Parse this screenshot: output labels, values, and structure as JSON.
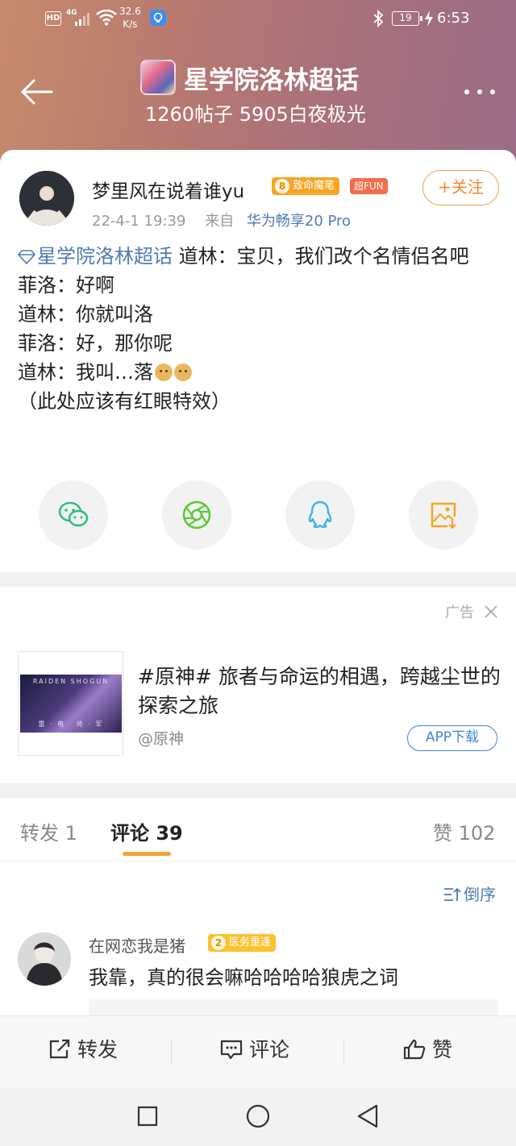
{
  "status_bar": {
    "hd": "HD",
    "network": "4G",
    "speed_value": "32.6",
    "speed_unit": "K/s",
    "battery": "19",
    "time": "6:53"
  },
  "header": {
    "topic_title": "星学院洛林超话",
    "topic_stats": "1260帖子 5905白夜极光"
  },
  "post": {
    "author": "梦里风在说着谁yu",
    "level_num": "8",
    "level_badge": "致命魔笔",
    "fun_badge": "超FUN",
    "follow_label": "+关注",
    "date": "22-4-1 19:39",
    "source_prefix": "来自",
    "device": "华为畅享20 Pro",
    "topic_link": "星学院洛林超话",
    "lines": [
      " 道林：宝贝，我们改个名情侣名吧",
      "菲洛：好啊",
      "道林：你就叫洛",
      "菲洛：好，那你呢",
      "道林：我叫…落",
      "（此处应该有红眼特效）"
    ]
  },
  "share": {
    "icons": [
      "wechat-icon",
      "moments-icon",
      "qq-icon",
      "save-image-icon"
    ]
  },
  "ad": {
    "label": "广告",
    "title": "#原神# 旅者与命运的相遇，跨越尘世的探索之旅",
    "source": "@原神",
    "button": "APP下载",
    "thumb_top": "RAIDEN SHOGUN",
    "thumb_bottom": "雷 · 电 · 将 · 军"
  },
  "tabs": {
    "repost": "转发 1",
    "comments": "评论 39",
    "likes": "赞 102"
  },
  "sort_label": "倒序",
  "comment": {
    "author": "在网恋我是猪",
    "level_num": "2",
    "badge": "医务重逢",
    "text": "我靠，真的很会嘛哈哈哈哈狼虎之词"
  },
  "actions": {
    "repost": "转发",
    "comment": "评论",
    "like": "赞"
  },
  "colors": {
    "accent_orange": "#f08a2d",
    "link_blue": "#4e7cb5",
    "tab_underline": "#f7a33a"
  }
}
